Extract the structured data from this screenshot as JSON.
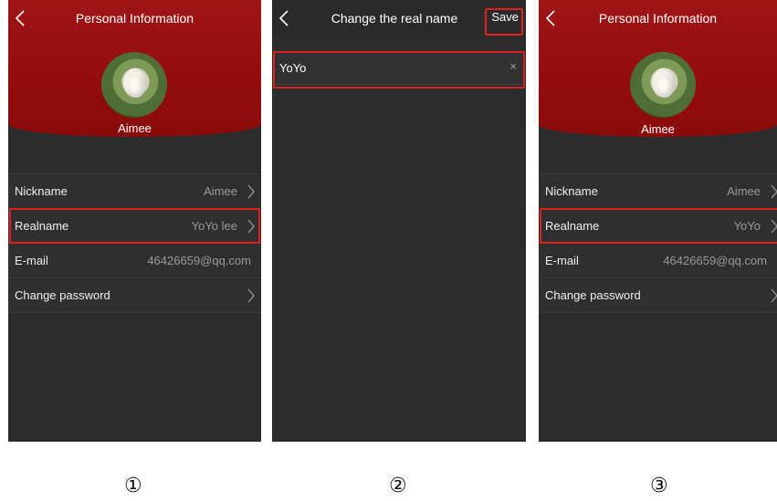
{
  "screens": [
    {
      "title": "Personal Information",
      "username": "Aimee",
      "rows": [
        {
          "label": "Nickname",
          "value": "Aimee"
        },
        {
          "label": "Realname",
          "value": "YoYo lee"
        },
        {
          "label": "E-mail",
          "value": "46426659@qq.com"
        },
        {
          "label": "Change password",
          "value": ""
        }
      ]
    },
    {
      "title": "Change the real name",
      "save_label": "Save",
      "input_value": "YoYo",
      "clear_label": "×"
    },
    {
      "title": "Personal Information",
      "username": "Aimee",
      "rows": [
        {
          "label": "Nickname",
          "value": "Aimee"
        },
        {
          "label": "Realname",
          "value": "YoYo"
        },
        {
          "label": "E-mail",
          "value": "46426659@qq.com"
        },
        {
          "label": "Change password",
          "value": ""
        }
      ]
    }
  ],
  "steps": [
    "①",
    "②",
    "③"
  ],
  "colors": {
    "header_red": "#930d0d",
    "highlight_red": "#e0201f",
    "screen_bg": "#2c2c2c"
  }
}
